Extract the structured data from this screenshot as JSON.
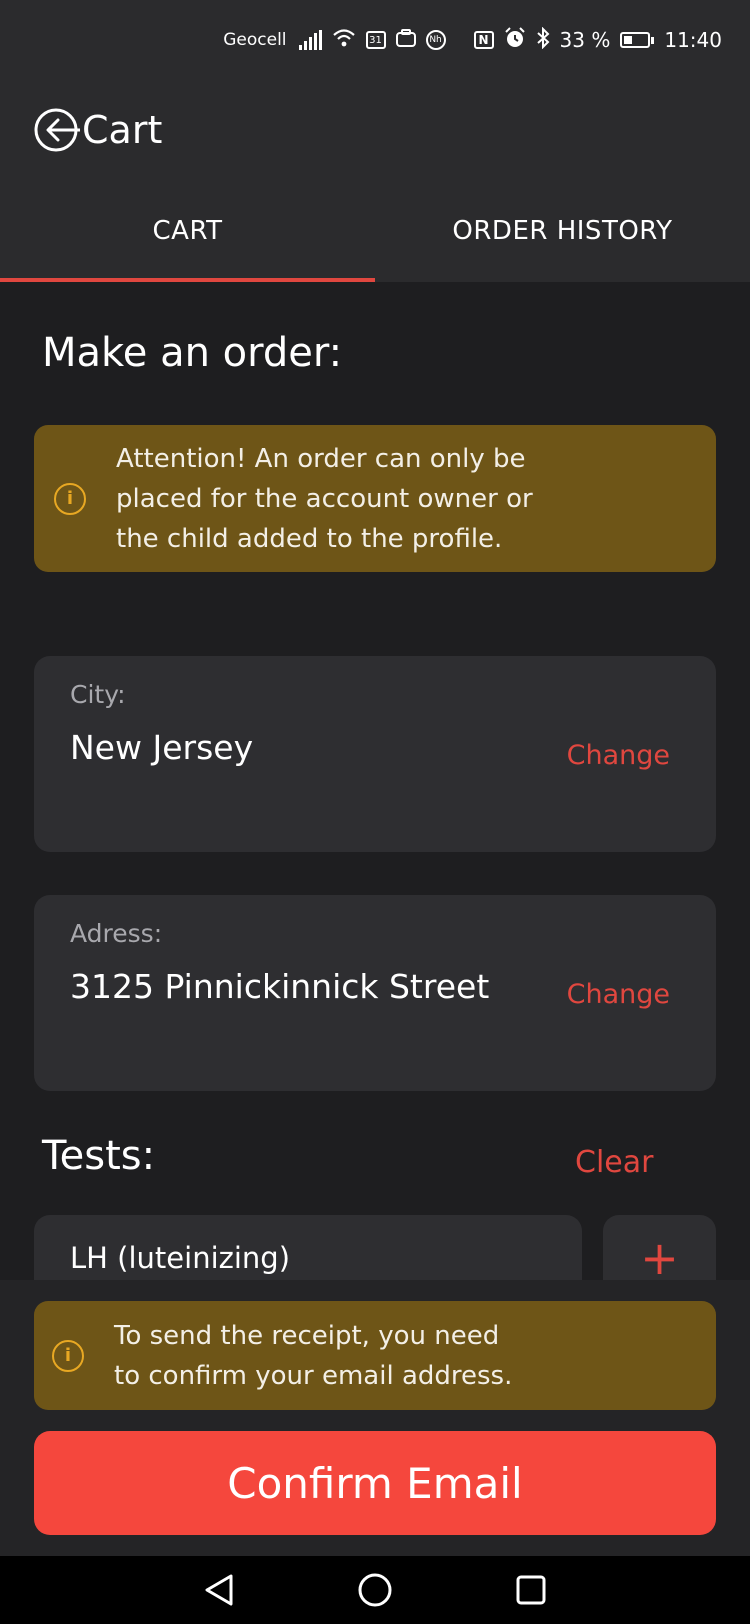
{
  "status_bar": {
    "carrier": "Geocell",
    "calendar_day": "31",
    "nh_label": "Nh",
    "nfc_label": "N",
    "battery": "33 %",
    "time": "11:40"
  },
  "header": {
    "title": "Cart"
  },
  "tabs": [
    {
      "label": "CART",
      "active": true
    },
    {
      "label": "ORDER HISTORY",
      "active": false
    }
  ],
  "main": {
    "heading": "Make an order:",
    "attention_line1": "Attention! An order can only be",
    "attention_line2": "placed for the account owner or",
    "attention_line3": "the child added to the profile.",
    "city": {
      "label": "City:",
      "value": "New Jersey",
      "action": "Change"
    },
    "address": {
      "label": "Adress:",
      "value": "3125 Pinnickinnick Street",
      "action": "Change"
    },
    "tests_heading": "Tests:",
    "clear_label": "Clear",
    "tests": [
      {
        "name": "LH (luteinizing)"
      }
    ],
    "add_symbol": "+"
  },
  "footer": {
    "receipt_line1": "To send the receipt, you need",
    "receipt_line2": "to confirm your email address.",
    "confirm_label": "Confirm Email"
  },
  "info_glyph": "i",
  "colors": {
    "accent": "#e0473f",
    "button": "#f5473d",
    "warning_bg": "#6e5517",
    "warning_icon": "#e8a823",
    "card_bg": "#2e2e31",
    "page_bg": "#1e1e20"
  }
}
